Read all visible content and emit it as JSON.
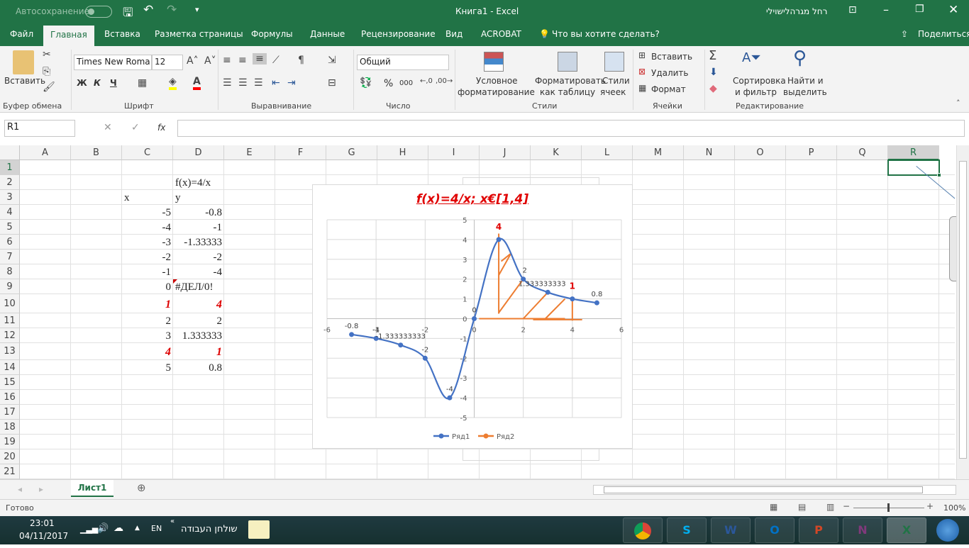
{
  "titlebar": {
    "autosave_label": "Автосохранение",
    "title": "Книга1  -  Excel",
    "user": "רחל מגרהלישוילי"
  },
  "tabs": [
    "Файл",
    "Главная",
    "Вставка",
    "Разметка страницы",
    "Формулы",
    "Данные",
    "Рецензирование",
    "Вид",
    "ACROBAT"
  ],
  "active_tab": "Главная",
  "tell_me": "Что вы хотите сделать?",
  "share": "Поделиться",
  "ribbon": {
    "clipboard": {
      "paste": "Вставить",
      "group": "Буфер обмена"
    },
    "font": {
      "name": "Times New Roma",
      "size": "12",
      "bold": "Ж",
      "italic": "К",
      "underline": "Ч",
      "group": "Шрифт",
      "highlight_color": "#ffff00",
      "font_color": "#ff0000"
    },
    "alignment": {
      "group": "Выравнивание"
    },
    "number": {
      "format": "Общий",
      "percent": "%",
      "thousands": "000",
      "group": "Число"
    },
    "styles": {
      "conditional": [
        "Условное",
        "форматирование"
      ],
      "as_table": [
        "Форматировать",
        "как таблицу"
      ],
      "cell_styles": [
        "Стили",
        "ячеек"
      ],
      "group": "Стили"
    },
    "cells": {
      "insert": "Вставить",
      "delete": "Удалить",
      "format": "Формат",
      "group": "Ячейки"
    },
    "editing": {
      "sort": [
        "Сортировка",
        "и фильтр"
      ],
      "find": [
        "Найти и",
        "выделить"
      ],
      "group": "Редактирование"
    }
  },
  "formula_bar": {
    "name_box": "R1",
    "fx": "fx",
    "value": ""
  },
  "columns": [
    "A",
    "B",
    "C",
    "D",
    "E",
    "F",
    "G",
    "H",
    "I",
    "J",
    "K",
    "L",
    "M",
    "N",
    "O",
    "P",
    "Q",
    "R"
  ],
  "rows": [
    "1",
    "2",
    "3",
    "4",
    "5",
    "6",
    "7",
    "8",
    "9",
    "10",
    "11",
    "12",
    "13",
    "14",
    "15",
    "16",
    "17",
    "18",
    "19",
    "20",
    "21"
  ],
  "selected_cell": "R1",
  "cells": [
    {
      "ref": "D2",
      "v": "f(x)=4/x"
    },
    {
      "ref": "C3",
      "v": "x"
    },
    {
      "ref": "D3",
      "v": "y"
    },
    {
      "ref": "C4",
      "v": "-5"
    },
    {
      "ref": "D4",
      "v": "-0.8"
    },
    {
      "ref": "C5",
      "v": "-4"
    },
    {
      "ref": "D5",
      "v": "-1"
    },
    {
      "ref": "C6",
      "v": "-3"
    },
    {
      "ref": "D6",
      "v": "-1.33333"
    },
    {
      "ref": "C7",
      "v": "-2"
    },
    {
      "ref": "D7",
      "v": "-2"
    },
    {
      "ref": "C8",
      "v": "-1"
    },
    {
      "ref": "D8",
      "v": "-4"
    },
    {
      "ref": "C9",
      "v": "0"
    },
    {
      "ref": "D9",
      "v": "#ДЕЛ/0!"
    },
    {
      "ref": "C10",
      "v": "1",
      "style": "emph"
    },
    {
      "ref": "D10",
      "v": "4",
      "style": "emph"
    },
    {
      "ref": "C11",
      "v": "2"
    },
    {
      "ref": "D11",
      "v": "2"
    },
    {
      "ref": "C12",
      "v": "3"
    },
    {
      "ref": "D12",
      "v": "1.333333"
    },
    {
      "ref": "C13",
      "v": "4",
      "style": "emph"
    },
    {
      "ref": "D13",
      "v": "1",
      "style": "emph"
    },
    {
      "ref": "C14",
      "v": "5"
    },
    {
      "ref": "D14",
      "v": "0.8"
    }
  ],
  "chart_data": {
    "type": "scatter",
    "title": "f(x)=4/x; x€[1,4]",
    "title_color": "#e00000",
    "xlim": [
      -6,
      6
    ],
    "ylim": [
      -5,
      5
    ],
    "xticks": [
      "-6",
      "-4",
      "-2",
      "0",
      "2",
      "4",
      "6"
    ],
    "yticks": [
      "-5",
      "-4",
      "-3",
      "-2",
      "-1",
      "0",
      "1",
      "2",
      "3",
      "4",
      "5"
    ],
    "grid": true,
    "legend": "bottom",
    "series": [
      {
        "name": "Ряд1",
        "color": "#4472c4",
        "smooth": true,
        "x": [
          -5,
          -4,
          -3,
          -2,
          -1,
          0,
          1,
          2,
          3,
          4,
          5
        ],
        "y": [
          -0.8,
          -1,
          -1.333333333,
          -2,
          -4,
          0,
          4,
          2,
          1.333333333,
          1,
          0.8
        ],
        "labels": [
          "-0.8",
          "-1",
          "-1.333333333",
          "-2",
          "-4",
          "0",
          "4",
          "2",
          "1.333333333",
          "1",
          "0.8"
        ],
        "highlight_labels": [
          "4",
          "1"
        ],
        "highlight_color": "#e00000"
      },
      {
        "name": "Ряд2",
        "color": "#ed7d31",
        "segments": [
          [
            [
              1,
              0.25
            ],
            [
              1,
              4.3
            ]
          ],
          [
            [
              0.2,
              0
            ],
            [
              3.7,
              0
            ]
          ],
          [
            [
              2.4,
              -0.05
            ],
            [
              4.4,
              -0.05
            ]
          ],
          [
            [
              4,
              -0.1
            ],
            [
              4,
              1
            ]
          ],
          [
            [
              1,
              2.2
            ],
            [
              1.5,
              3.3
            ]
          ],
          [
            [
              1.1,
              2.9
            ],
            [
              1.5,
              3.3
            ]
          ],
          [
            [
              1,
              0.3
            ],
            [
              2,
              2
            ]
          ],
          [
            [
              2,
              0
            ],
            [
              3,
              1.33
            ]
          ],
          [
            [
              2.9,
              0
            ],
            [
              3.7,
              1
            ]
          ]
        ]
      }
    ]
  },
  "sheet_tabs": [
    "Лист1"
  ],
  "status": {
    "ready": "Готово",
    "zoom": "100%"
  },
  "taskbar": {
    "time": "23:01",
    "date": "04/11/2017",
    "lang": "EN",
    "desktop": "שולחן העבודה",
    "apps": [
      {
        "name": "chrome",
        "color": "#db4437",
        "label": ""
      },
      {
        "name": "skype",
        "color": "#00aff0",
        "label": "S"
      },
      {
        "name": "word",
        "color": "#2b579a",
        "label": "W"
      },
      {
        "name": "outlook",
        "color": "#0072c6",
        "label": "O"
      },
      {
        "name": "powerpoint",
        "color": "#d24726",
        "label": "P"
      },
      {
        "name": "onenote",
        "color": "#80397b",
        "label": "N"
      },
      {
        "name": "excel",
        "color": "#217346",
        "label": "X"
      }
    ]
  }
}
